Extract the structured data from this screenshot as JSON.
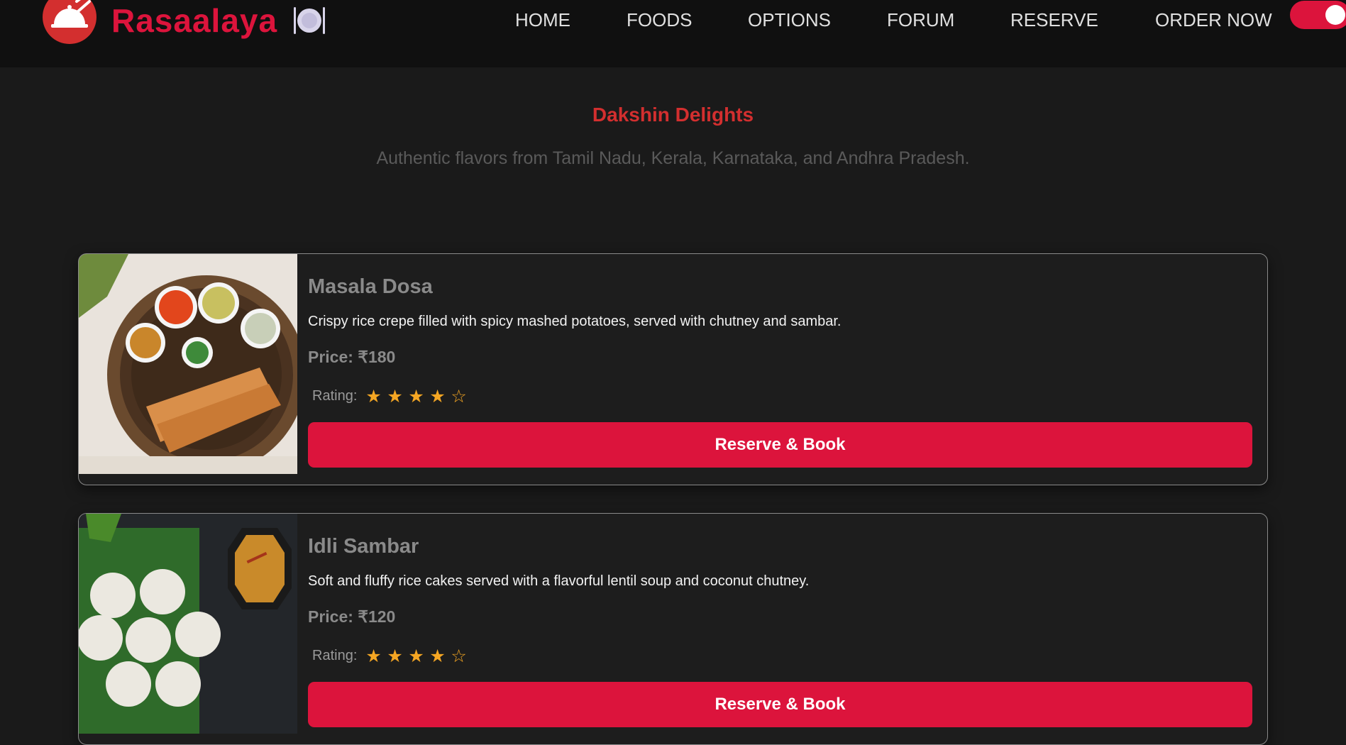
{
  "nav": {
    "brand": "Rasaalaya",
    "plate_emoji": "🍽️",
    "links": [
      "HOME",
      "FOODS",
      "OPTIONS",
      "FORUM",
      "RESERVE",
      "ORDER NOW"
    ],
    "toggle_on": true,
    "logo_icon": "cloche-fork-knife-icon",
    "plate_icon": "plate-cutlery-icon"
  },
  "hero": {
    "title": "Dakshin Delights",
    "subtitle": "Authentic flavors from Tamil Nadu, Kerala, Karnataka, and Andhra Pradesh."
  },
  "cards": [
    {
      "name": "Masala Dosa",
      "description": "Crispy rice crepe filled with spicy mashed potatoes, served with chutney and sambar.",
      "price": "Price: ₹180",
      "rating_label": "Rating:",
      "stars": "★ ★ ★ ★ ☆",
      "rating_value": 4,
      "rating_max": 5,
      "button": "Reserve & Book"
    },
    {
      "name": "Idli Sambar",
      "description": "Soft and fluffy rice cakes served with a flavorful lentil soup and coconut chutney.",
      "price": "Price: ₹120",
      "rating_label": "Rating:",
      "stars": "★ ★ ★ ★ ☆",
      "rating_value": 4,
      "rating_max": 5,
      "button": "Reserve & Book"
    }
  ],
  "colors": {
    "accent": "#dc143c",
    "title_red": "#d32f2f",
    "star": "#f5a623",
    "background": "#1a1a1a",
    "navbar": "#101010"
  }
}
